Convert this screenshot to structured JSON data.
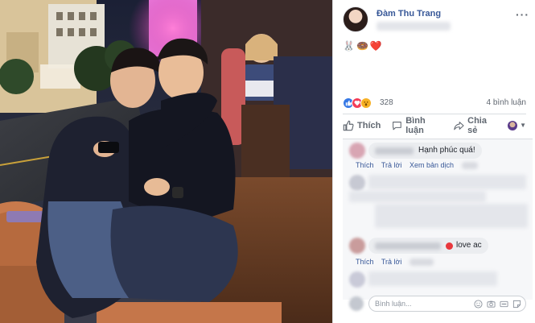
{
  "post": {
    "author": "Đàm Thu Trang",
    "more_label": "···",
    "text": "🐰🍩❤️"
  },
  "reactions": {
    "icons": [
      "like-icon",
      "love-icon",
      "wow-icon"
    ],
    "count": "328",
    "comments_count": "4 bình luận"
  },
  "actions": {
    "like": "Thích",
    "comment": "Bình luận",
    "share": "Chia sẻ"
  },
  "comments": [
    {
      "text": "Hạnh phúc quá!",
      "links": [
        "Thích",
        "Trả lời",
        "Xem bản dịch"
      ]
    },
    {
      "text": "love ac",
      "links": [
        "Thích",
        "Trả lời"
      ]
    }
  ],
  "composer": {
    "placeholder": "Bình luận..."
  },
  "colors": {
    "link": "#385898",
    "like": "#3578e5",
    "love": "#f33e58",
    "wow": "#f7b125"
  }
}
